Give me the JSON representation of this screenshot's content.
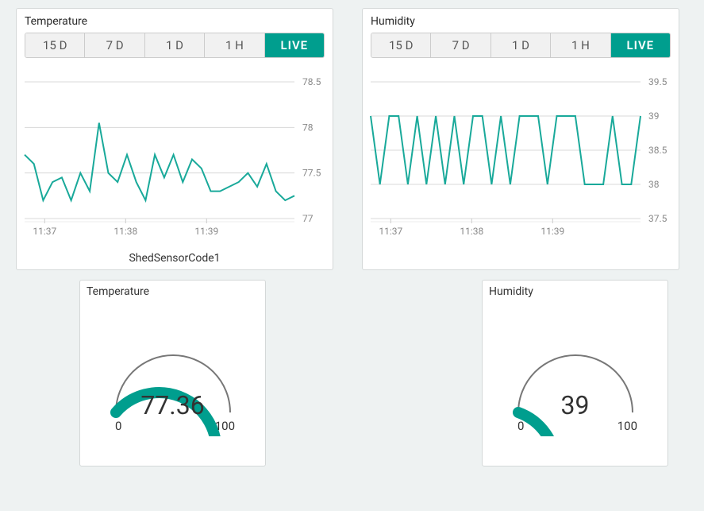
{
  "colors": {
    "accent": "#009e8e",
    "line": "#19a99a",
    "grid": "#d8d8d8",
    "axis": "#999"
  },
  "range_tabs": [
    "15 D",
    "7 D",
    "1 D",
    "1 H",
    "LIVE"
  ],
  "active_tab_idx": 4,
  "panels": {
    "temperature": {
      "title": "Temperature",
      "series_name": "ShedSensorCode1"
    },
    "humidity": {
      "title": "Humidity"
    }
  },
  "gauges": {
    "temperature": {
      "title": "Temperature",
      "value": "77.36",
      "min": "0",
      "max": "100",
      "fraction": 0.7736
    },
    "humidity": {
      "title": "Humidity",
      "value": "39",
      "min": "0",
      "max": "100",
      "fraction": 0.39
    }
  },
  "chart_data": [
    {
      "id": "temperature",
      "type": "line",
      "title": "Temperature",
      "xlabel": "",
      "ylabel": "",
      "ylim": [
        77,
        78.5
      ],
      "yticks": [
        77,
        77.5,
        78,
        78.5
      ],
      "xticks": [
        "11:37",
        "11:38",
        "11:39"
      ],
      "x": [
        0,
        1,
        2,
        3,
        4,
        5,
        6,
        7,
        8,
        9,
        10,
        11,
        12,
        13,
        14,
        15,
        16,
        17,
        18,
        19,
        20,
        21,
        22,
        23,
        24,
        25,
        26,
        27,
        28,
        29
      ],
      "series": [
        {
          "name": "ShedSensorCode1",
          "values": [
            77.7,
            77.6,
            77.2,
            77.4,
            77.45,
            77.2,
            77.5,
            77.3,
            78.05,
            77.5,
            77.4,
            77.7,
            77.4,
            77.2,
            77.7,
            77.45,
            77.7,
            77.4,
            77.65,
            77.55,
            77.3,
            77.3,
            77.35,
            77.4,
            77.5,
            77.35,
            77.6,
            77.3,
            77.2,
            77.25
          ]
        }
      ]
    },
    {
      "id": "humidity",
      "type": "line",
      "title": "Humidity",
      "xlabel": "",
      "ylabel": "",
      "ylim": [
        37.5,
        39.5
      ],
      "yticks": [
        37.5,
        38,
        38.5,
        39,
        39.5
      ],
      "xticks": [
        "11:37",
        "11:38",
        "11:39"
      ],
      "x": [
        0,
        1,
        2,
        3,
        4,
        5,
        6,
        7,
        8,
        9,
        10,
        11,
        12,
        13,
        14,
        15,
        16,
        17,
        18,
        19,
        20,
        21,
        22,
        23,
        24,
        25,
        26,
        27,
        28,
        29
      ],
      "series": [
        {
          "name": "Humidity",
          "values": [
            39,
            38,
            39,
            39,
            38,
            39,
            38,
            39,
            38,
            39,
            38,
            39,
            39,
            38,
            39,
            38,
            39,
            39,
            39,
            38,
            39,
            39,
            39,
            38,
            38,
            38,
            39,
            38,
            38,
            39
          ]
        }
      ]
    }
  ]
}
